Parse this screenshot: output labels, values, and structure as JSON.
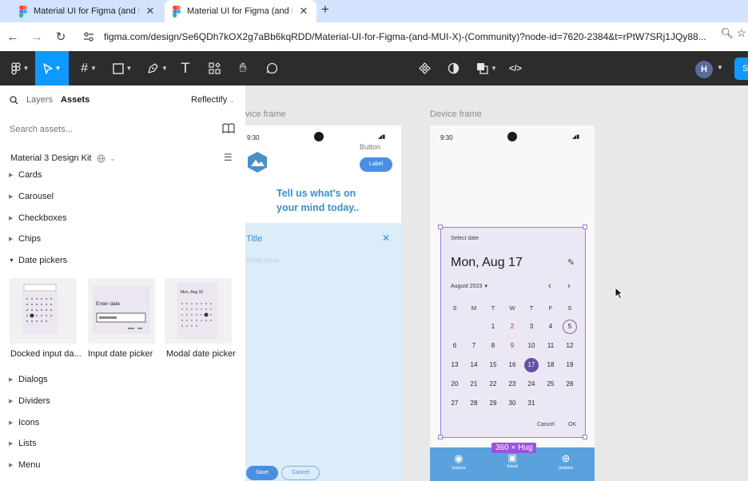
{
  "browser": {
    "tabs": [
      {
        "title": "Material UI for Figma (and Mi",
        "active": false
      },
      {
        "title": "Material UI for Figma (and Mi",
        "active": true
      }
    ],
    "new_tab": "+",
    "url": "figma.com/design/Se6QDh7kOX2g7aBb6kqRDD/Material-UI-for-Figma-(and-MUI-X)-(Community)?node-id=7620-2384&t=rPtW7SRj1JQy88..."
  },
  "toolbar": {
    "avatar_initial": "H",
    "share_label": "S",
    "icons": [
      "figma-menu-icon",
      "move-tool-icon",
      "frame-tool-icon",
      "shape-tool-icon",
      "pen-tool-icon",
      "text-tool-icon",
      "resources-icon",
      "hand-tool-icon",
      "comment-icon",
      "components-icon",
      "theme-icon",
      "boolean-icon",
      "dev-mode-icon"
    ]
  },
  "left_panel": {
    "tab_layers": "Layers",
    "tab_assets": "Assets",
    "library": "Reflectify",
    "search_placeholder": "Search assets...",
    "library_title": "Material 3 Design Kit",
    "categories_top": [
      "Cards",
      "Carousel",
      "Checkboxes",
      "Chips"
    ],
    "expanded_category": "Date pickers",
    "thumbnails": [
      {
        "label": "Docked input da..."
      },
      {
        "label": "Input date picker",
        "field_label": "Enter date"
      },
      {
        "label": "Modal date picker",
        "date": "Mon, Aug 16"
      }
    ],
    "categories_bottom": [
      "Dialogs",
      "Dividers",
      "Icons",
      "Lists",
      "Menu"
    ]
  },
  "canvas": {
    "frame_label_1": "vice frame",
    "frame_label_2": "Device frame",
    "phone1": {
      "time": "9:30",
      "button_text": "Button",
      "label_chip": "Label",
      "headline_1": "Tell us what's on",
      "headline_2": "your mind today..",
      "sheet_title": "Title",
      "sheet_placeholder": "Write here",
      "save": "Save",
      "cancel": "Cancel"
    },
    "phone2": {
      "time": "9:30",
      "size_badge": "360 × Hug",
      "nav": [
        "Explore",
        "Saved",
        "Updates"
      ]
    },
    "date_picker": {
      "select_label": "Select date",
      "date_title": "Mon, Aug 17",
      "month_year": "August 2023",
      "weekdays": [
        "S",
        "M",
        "T",
        "W",
        "T",
        "F",
        "S"
      ],
      "weeks": [
        [
          "",
          "",
          "1",
          "2",
          "3",
          "4",
          "5"
        ],
        [
          "6",
          "7",
          "8",
          "9",
          "10",
          "11",
          "12"
        ],
        [
          "13",
          "14",
          "15",
          "16",
          "17",
          "18",
          "19"
        ],
        [
          "20",
          "21",
          "22",
          "23",
          "24",
          "25",
          "26"
        ],
        [
          "27",
          "28",
          "29",
          "30",
          "31",
          "",
          ""
        ]
      ],
      "today": "5",
      "selected": "17",
      "highlighted": [
        "2",
        "9"
      ],
      "cancel": "Cancel",
      "ok": "OK"
    }
  },
  "colors": {
    "figma_blue": "#0d99ff",
    "toolbar_bg": "#2c2c2c",
    "selection_purple": "#9b51e0",
    "material_primary": "#6750a4",
    "nav_blue": "#5aa2de"
  }
}
